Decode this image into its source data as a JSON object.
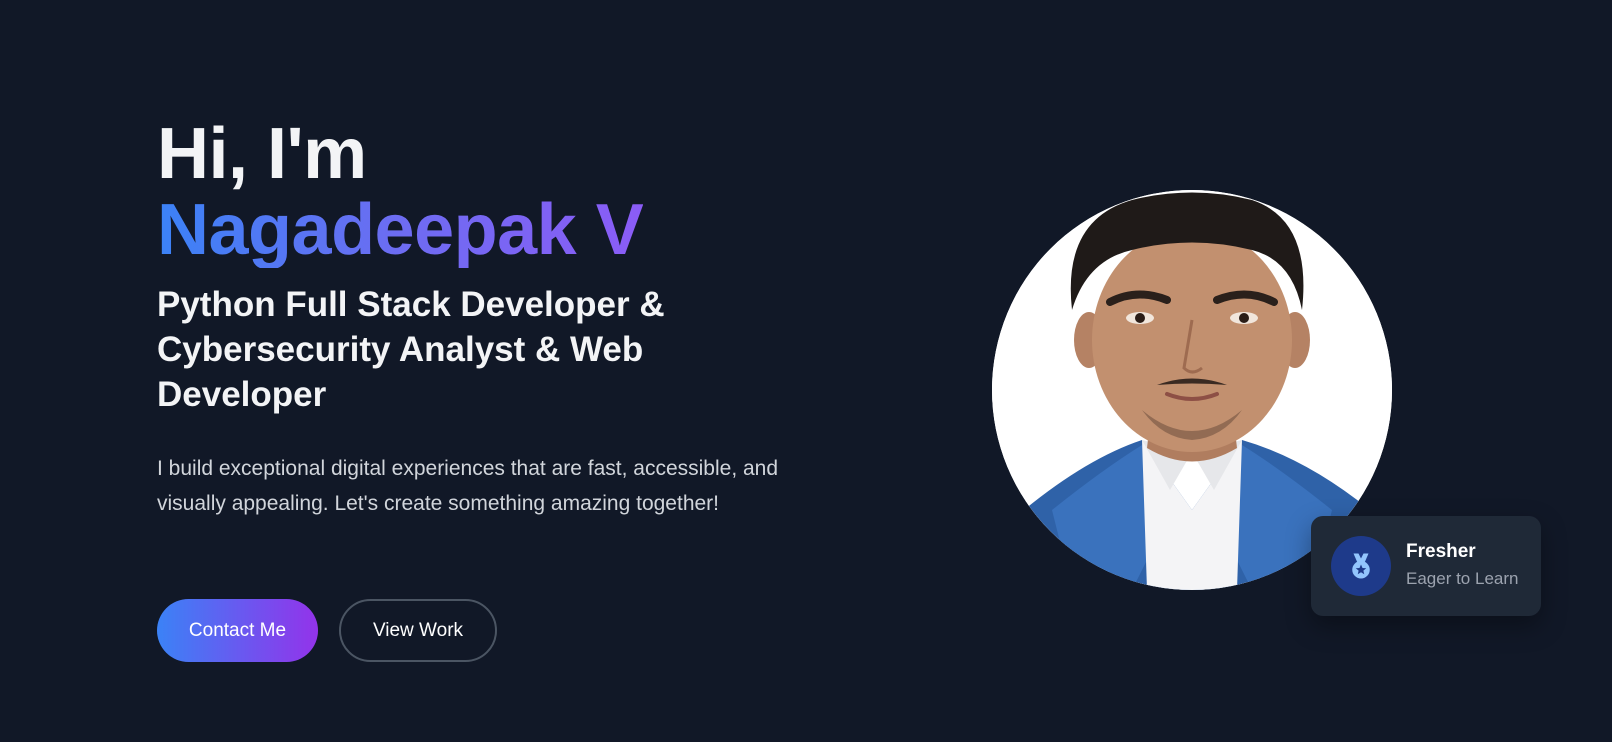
{
  "hero": {
    "greeting": "Hi, I'm",
    "name": "Nagadeepak V",
    "role": "Python Full Stack Developer & Cybersecurity Analyst & Web Developer",
    "description": "I build exceptional digital experiences that are fast, accessible, and visually appealing. Let's create something amazing together!",
    "buttons": {
      "primary_label": "Contact Me",
      "secondary_label": "View Work"
    }
  },
  "badge": {
    "icon": "medal-icon",
    "title": "Fresher",
    "subtitle": "Eager to Learn"
  },
  "colors": {
    "background": "#111827",
    "accent_blue": "#3b82f6",
    "accent_purple": "#8b5cf6",
    "card": "#1f2937"
  }
}
